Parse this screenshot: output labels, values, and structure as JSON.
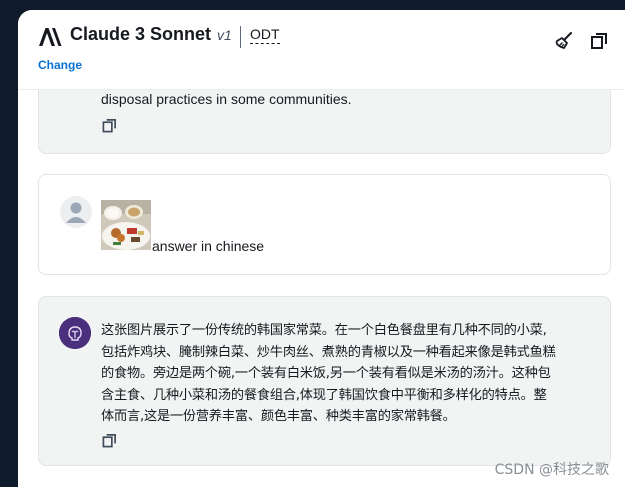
{
  "header": {
    "model_name": "Claude 3 Sonnet",
    "model_version": "v1",
    "model_tag": "ODT",
    "change_label": "Change",
    "icons": [
      "anthropic-logo-icon",
      "clear-broom-icon",
      "copy-icon"
    ]
  },
  "messages": [
    {
      "role": "assistant",
      "text_tail": "disposal practices in some communities.",
      "icons": [
        "copy-icon"
      ]
    },
    {
      "role": "user",
      "attachment": "food-photo-thumbnail",
      "text": "answer in chinese",
      "icons": [
        "user-avatar-icon"
      ]
    },
    {
      "role": "assistant",
      "lines": [
        "这张图片展示了一份传统的韩国家常菜。在一个白色餐盘里有几种不同的小菜,",
        "包括炸鸡块、腌制辣白菜、炒牛肉丝、煮熟的青椒以及一种看起来像是韩式鱼糕",
        "的食物。旁边是两个碗,一个装有白米饭,另一个装有看似是米汤的汤汁。这种包",
        "含主食、几种小菜和汤的餐食组合,体现了韩国饮食中平衡和多样化的特点。整",
        "体而言,这是一份营养丰富、颜色丰富、种类丰富的家常韩餐。"
      ],
      "icons": [
        "assistant-avatar-icon",
        "copy-icon"
      ]
    }
  ],
  "watermark": "CSDN @科技之歌",
  "colors": {
    "link": "#0972d3",
    "bubble_gray": "#f2f3f3",
    "assistant_avatar": "#4a2f7d",
    "backdrop": "#0f1b2a"
  }
}
